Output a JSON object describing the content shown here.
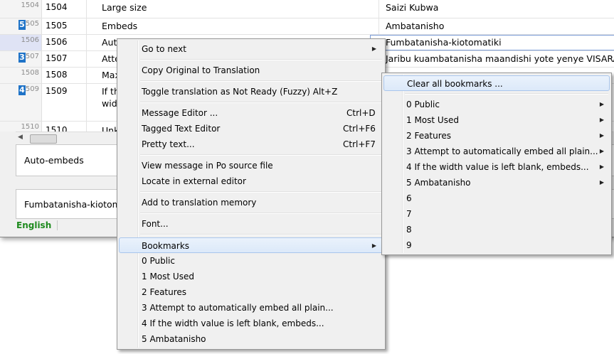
{
  "grid": {
    "rows": [
      {
        "gutter": "1504",
        "badge": "",
        "id": "1504",
        "source": "Large size",
        "translation": "Saizi Kubwa"
      },
      {
        "gutter": "505",
        "badge": "5",
        "id": "1505",
        "source": "Embeds",
        "translation": "Ambatanisho"
      },
      {
        "gutter": "1506",
        "badge": "",
        "id": "1506",
        "source": "Auto",
        "translation": "Fumbatanisha-kiotomatiki"
      },
      {
        "gutter": "507",
        "badge": "3",
        "id": "1507",
        "source": "Atte",
        "translation": "Jaribu kuambatanisha maandishi yote yenye VISARA"
      },
      {
        "gutter": "1508",
        "badge": "",
        "id": "1508",
        "source": "Max",
        "translation": ""
      },
      {
        "gutter": "509",
        "badge": "4",
        "id": "1509",
        "source": "If th",
        "source2": "widt",
        "translation": ""
      },
      {
        "gutter": "1510",
        "badge": "",
        "id": "1510",
        "source": "Unk",
        "translation": ""
      }
    ]
  },
  "source_panel": {
    "text": "Auto-embeds"
  },
  "translation_panel": {
    "text": "Fumbatanisha-kiotomat"
  },
  "status": {
    "language": "English"
  },
  "context_menu": {
    "items": [
      {
        "label": "Go to next",
        "shortcut": "",
        "submenu": true
      },
      {
        "label": "Copy Original to Translation",
        "shortcut": ""
      },
      {
        "label": "Toggle translation as Not Ready  (Fuzzy)  Alt+Z",
        "shortcut": ""
      },
      {
        "label": "Message Editor ...",
        "shortcut": "Ctrl+D"
      },
      {
        "label": "Tagged Text Editor",
        "shortcut": "Ctrl+F6"
      },
      {
        "label": "Pretty text...",
        "shortcut": "Ctrl+F7"
      },
      {
        "label": "View message in Po source file",
        "shortcut": ""
      },
      {
        "label": "Locate in external editor",
        "shortcut": ""
      },
      {
        "label": "Add to translation memory",
        "shortcut": ""
      },
      {
        "label": "Font...",
        "shortcut": ""
      },
      {
        "label": "Bookmarks",
        "shortcut": "",
        "submenu": true
      },
      {
        "label": "0 Public",
        "shortcut": ""
      },
      {
        "label": "1 Most Used",
        "shortcut": ""
      },
      {
        "label": "2 Features",
        "shortcut": ""
      },
      {
        "label": "3 Attempt to automatically embed all plain...",
        "shortcut": ""
      },
      {
        "label": "4 If the width value is left blank, embeds...",
        "shortcut": ""
      },
      {
        "label": "5 Ambatanisho",
        "shortcut": ""
      }
    ]
  },
  "bookmarks_menu": {
    "items": [
      {
        "label": "Clear all bookmarks ...",
        "submenu": false
      },
      {
        "label": "0 Public",
        "submenu": true
      },
      {
        "label": "1 Most Used",
        "submenu": true
      },
      {
        "label": "2 Features",
        "submenu": true
      },
      {
        "label": "3 Attempt to automatically embed all plain...",
        "submenu": true
      },
      {
        "label": "4 If the width value is left blank, embeds...",
        "submenu": true
      },
      {
        "label": "5 Ambatanisho",
        "submenu": true
      },
      {
        "label": "6",
        "submenu": false
      },
      {
        "label": "7",
        "submenu": false
      },
      {
        "label": "8",
        "submenu": false
      },
      {
        "label": "9",
        "submenu": false
      }
    ]
  },
  "icons": {
    "submenu_arrow": "triangle-right-icon",
    "scroll_left": "triangle-left-icon"
  },
  "colors": {
    "badge": "#1f73c7",
    "language": "#1d8a1d",
    "highlight": "#dce9f9"
  }
}
